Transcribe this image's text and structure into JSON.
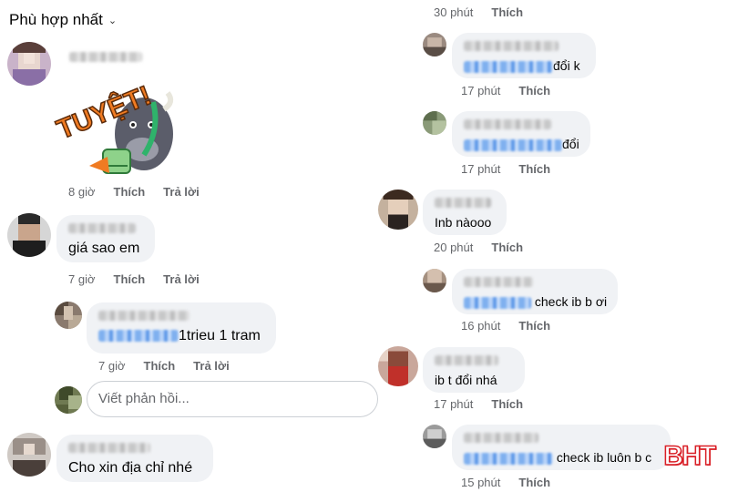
{
  "header": {
    "sort_label": "Phù hợp nhất",
    "sort_icon": "chevron-down-icon"
  },
  "actions": {
    "like": "Thích",
    "reply": "Trả lời"
  },
  "left": {
    "c1": {
      "time": "8 giờ",
      "sticker_text": "TUYỆT!"
    },
    "c2": {
      "text": "giá sao em",
      "time": "7 giờ"
    },
    "c3": {
      "text": "1trieu 1 tram",
      "time": "7 giờ"
    },
    "reply_placeholder": "Viết phản hồi...",
    "c4": {
      "text": "Cho xin địa chỉ nhé"
    }
  },
  "right": {
    "r0": {
      "time": "30 phút"
    },
    "r1": {
      "text": "đổi k",
      "time": "17 phút"
    },
    "r2": {
      "text": "đổi",
      "time": "17 phút"
    },
    "r3": {
      "text": "Inb nàooo",
      "time": "20 phút"
    },
    "r4": {
      "text": "check ib b ơi",
      "time": "16 phút"
    },
    "r5": {
      "text": "ib t đổi nhá",
      "time": "17 phút"
    },
    "r6": {
      "text": "check ib luôn b c",
      "time": "15 phút"
    }
  },
  "watermark": "BHT",
  "colors": {
    "bubble": "#f0f2f5",
    "meta": "#65676b",
    "mention": "#1877f2",
    "watermark": "#d91f26"
  }
}
